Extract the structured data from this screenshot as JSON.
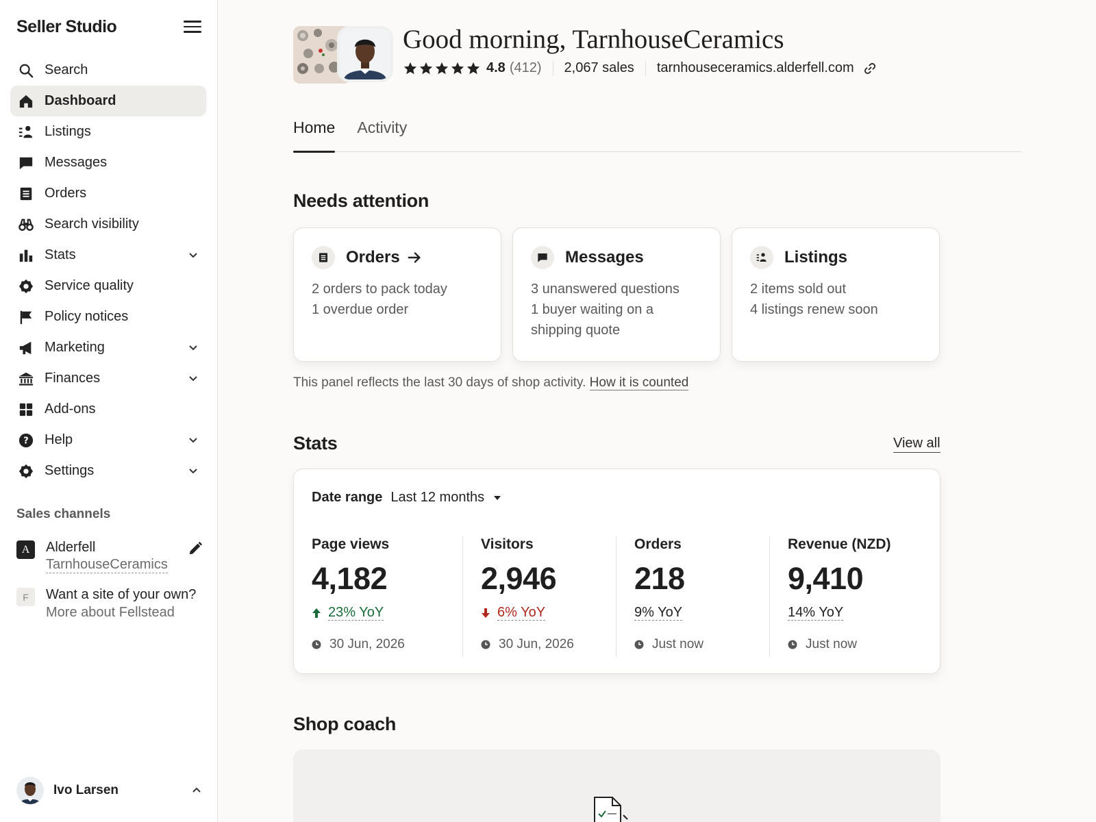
{
  "sidebar": {
    "brand": "Seller Studio",
    "nav": [
      {
        "label": "Search",
        "icon": "search-icon"
      },
      {
        "label": "Dashboard",
        "icon": "home-icon",
        "active": true
      },
      {
        "label": "Listings",
        "icon": "listings-icon"
      },
      {
        "label": "Messages",
        "icon": "message-icon"
      },
      {
        "label": "Orders",
        "icon": "receipt-icon"
      },
      {
        "label": "Search visibility",
        "icon": "binoculars-icon"
      },
      {
        "label": "Stats",
        "icon": "bar-chart-icon",
        "expandable": true
      },
      {
        "label": "Service quality",
        "icon": "badge-icon"
      },
      {
        "label": "Policy notices",
        "icon": "flag-icon"
      },
      {
        "label": "Marketing",
        "icon": "megaphone-icon",
        "expandable": true
      },
      {
        "label": "Finances",
        "icon": "bank-icon",
        "expandable": true
      },
      {
        "label": "Add-ons",
        "icon": "grid-icon"
      },
      {
        "label": "Help",
        "icon": "help-icon",
        "expandable": true
      },
      {
        "label": "Settings",
        "icon": "gear-icon",
        "expandable": true
      }
    ],
    "sales_channels_title": "Sales channels",
    "channel_primary": {
      "badge": "A",
      "name": "Alderfell",
      "shop": "TarnhouseCeramics"
    },
    "channel_secondary": {
      "badge": "F",
      "line1": "Want a site of your own?",
      "line2": "More about Fellstead"
    },
    "user_name": "Ivo Larsen"
  },
  "header": {
    "greeting": "Good morning, TarnhouseCeramics",
    "rating": "4.8",
    "rating_count": "(412)",
    "stars": 5,
    "sales": "2,067 sales",
    "url": "tarnhouseceramics.alderfell.com"
  },
  "tabs": [
    {
      "label": "Home",
      "active": true
    },
    {
      "label": "Activity"
    }
  ],
  "attention": {
    "title": "Needs attention",
    "cards": [
      {
        "title": "Orders",
        "icon": "receipt-icon",
        "lines": [
          "2 orders to pack today",
          "1 overdue order"
        ]
      },
      {
        "title": "Messages",
        "icon": "message-icon",
        "lines": [
          "3 unanswered questions",
          "1 buyer waiting on a",
          "shipping quote"
        ]
      },
      {
        "title": "Listings",
        "icon": "listings-icon",
        "lines": [
          "2 items sold out",
          "4 listings renew soon"
        ]
      }
    ],
    "note": "This panel reflects the last 30 days of shop activity.",
    "note_link": "How it is counted"
  },
  "stats": {
    "title": "Stats",
    "view_all": "View all",
    "range_label": "Date range",
    "range_value": "Last 12 months",
    "metrics": [
      {
        "label": "Page views",
        "value": "4,182",
        "delta": "23% YoY",
        "trend": "up",
        "time": "30 Jun, 2026"
      },
      {
        "label": "Visitors",
        "value": "2,946",
        "delta": "6% YoY",
        "trend": "down",
        "time": "30 Jun, 2026"
      },
      {
        "label": "Orders",
        "value": "218",
        "delta": "9% YoY",
        "trend": "flat",
        "time": "Just now"
      },
      {
        "label": "Revenue (NZD)",
        "value": "9,410",
        "delta": "14% YoY",
        "trend": "flat",
        "time": "Just now"
      }
    ]
  },
  "coach": {
    "title": "Shop coach"
  },
  "colors": {
    "positive": "#1b6b3a",
    "negative": "#b0291f",
    "active_nav_bg": "#eeece8"
  }
}
